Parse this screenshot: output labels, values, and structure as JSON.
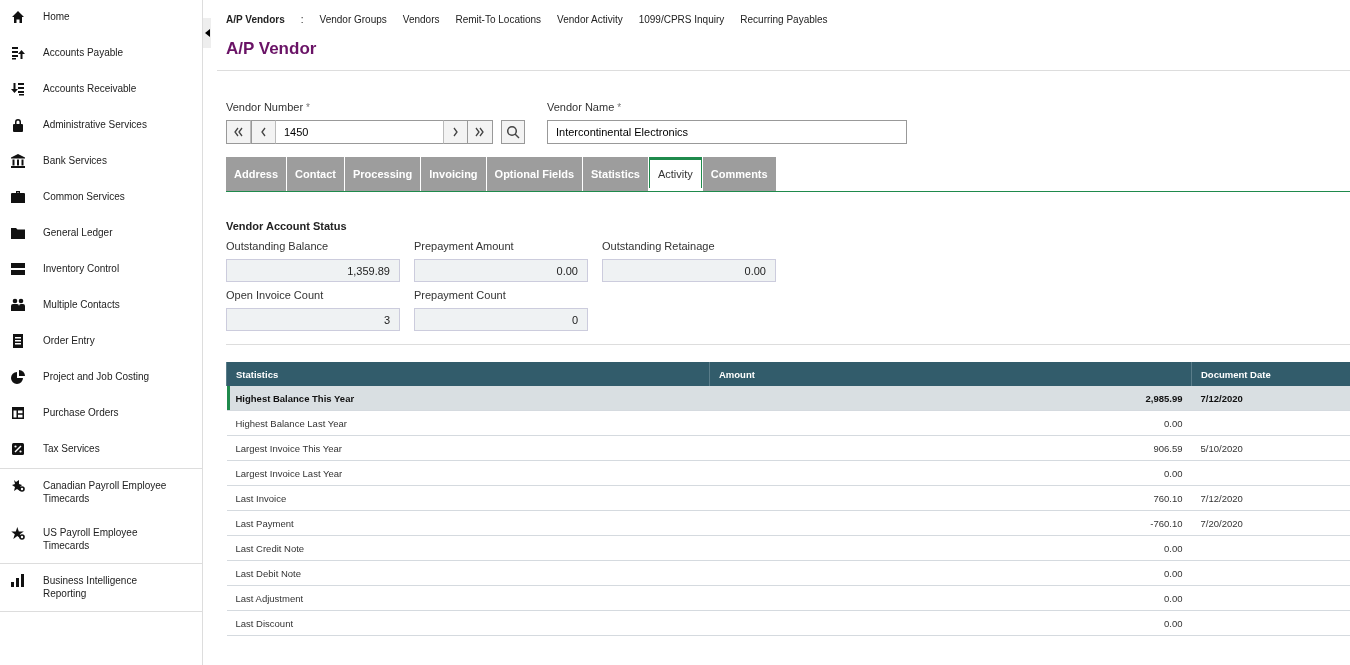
{
  "sidebar": {
    "groups": [
      {
        "items": [
          {
            "label": "Home"
          },
          {
            "label": "Accounts Payable"
          },
          {
            "label": "Accounts Receivable"
          },
          {
            "label": "Administrative Services"
          },
          {
            "label": "Bank Services"
          },
          {
            "label": "Common Services"
          },
          {
            "label": "General Ledger"
          },
          {
            "label": "Inventory Control"
          },
          {
            "label": "Multiple Contacts"
          },
          {
            "label": "Order Entry"
          },
          {
            "label": "Project and Job Costing"
          },
          {
            "label": "Purchase Orders"
          },
          {
            "label": "Tax Services"
          }
        ]
      },
      {
        "items": [
          {
            "label": "Canadian Payroll Employee Timecards"
          },
          {
            "label": "US Payroll Employee Timecards"
          }
        ]
      },
      {
        "items": [
          {
            "label": "Business Intelligence Reporting"
          }
        ]
      }
    ]
  },
  "top_nav": {
    "current": "A/P Vendors",
    "separator": ":",
    "links": [
      "Vendor Groups",
      "Vendors",
      "Remit-To Locations",
      "Vendor Activity",
      "1099/CPRS Inquiry",
      "Recurring Payables"
    ]
  },
  "page_title": "A/P Vendor",
  "vendor_number": {
    "label": "Vendor Number",
    "required_mark": "*",
    "value": "1450"
  },
  "vendor_name": {
    "label": "Vendor Name",
    "required_mark": "*",
    "value": "Intercontinental Electronics"
  },
  "tabs": [
    {
      "label": "Address",
      "selected": false
    },
    {
      "label": "Contact",
      "selected": false
    },
    {
      "label": "Processing",
      "selected": false
    },
    {
      "label": "Invoicing",
      "selected": false
    },
    {
      "label": "Optional Fields",
      "selected": false
    },
    {
      "label": "Statistics",
      "selected": false
    },
    {
      "label": "Activity",
      "selected": true
    },
    {
      "label": "Comments",
      "selected": false
    }
  ],
  "account_status": {
    "title": "Vendor Account Status",
    "fields": [
      {
        "label": "Outstanding Balance",
        "value": "1,359.89"
      },
      {
        "label": "Prepayment Amount",
        "value": "0.00"
      },
      {
        "label": "Outstanding Retainage",
        "value": "0.00"
      },
      {
        "label": "Open Invoice Count",
        "value": "3"
      },
      {
        "label": "Prepayment Count",
        "value": "0"
      }
    ]
  },
  "table": {
    "columns": [
      "Statistics",
      "Amount",
      "Document Date"
    ],
    "rows": [
      {
        "statistic": "Highest Balance This Year",
        "amount": "2,985.99",
        "date": "7/12/2020",
        "selected": true
      },
      {
        "statistic": "Highest Balance Last Year",
        "amount": "0.00",
        "selected": false
      },
      {
        "statistic": "Largest Invoice This Year",
        "amount": "906.59",
        "date": "5/10/2020",
        "selected": false
      },
      {
        "statistic": "Largest Invoice Last Year",
        "amount": "0.00",
        "selected": false
      },
      {
        "statistic": "Last Invoice",
        "amount": "760.10",
        "date": "7/12/2020",
        "selected": false
      },
      {
        "statistic": "Last Payment",
        "amount": "-760.10",
        "date": "7/20/2020",
        "selected": false
      },
      {
        "statistic": "Last Credit Note",
        "amount": "0.00",
        "selected": false
      },
      {
        "statistic": "Last Debit Note",
        "amount": "0.00",
        "selected": false
      },
      {
        "statistic": "Last Adjustment",
        "amount": "0.00",
        "selected": false
      },
      {
        "statistic": "Last Discount",
        "amount": "0.00",
        "selected": false
      }
    ]
  }
}
